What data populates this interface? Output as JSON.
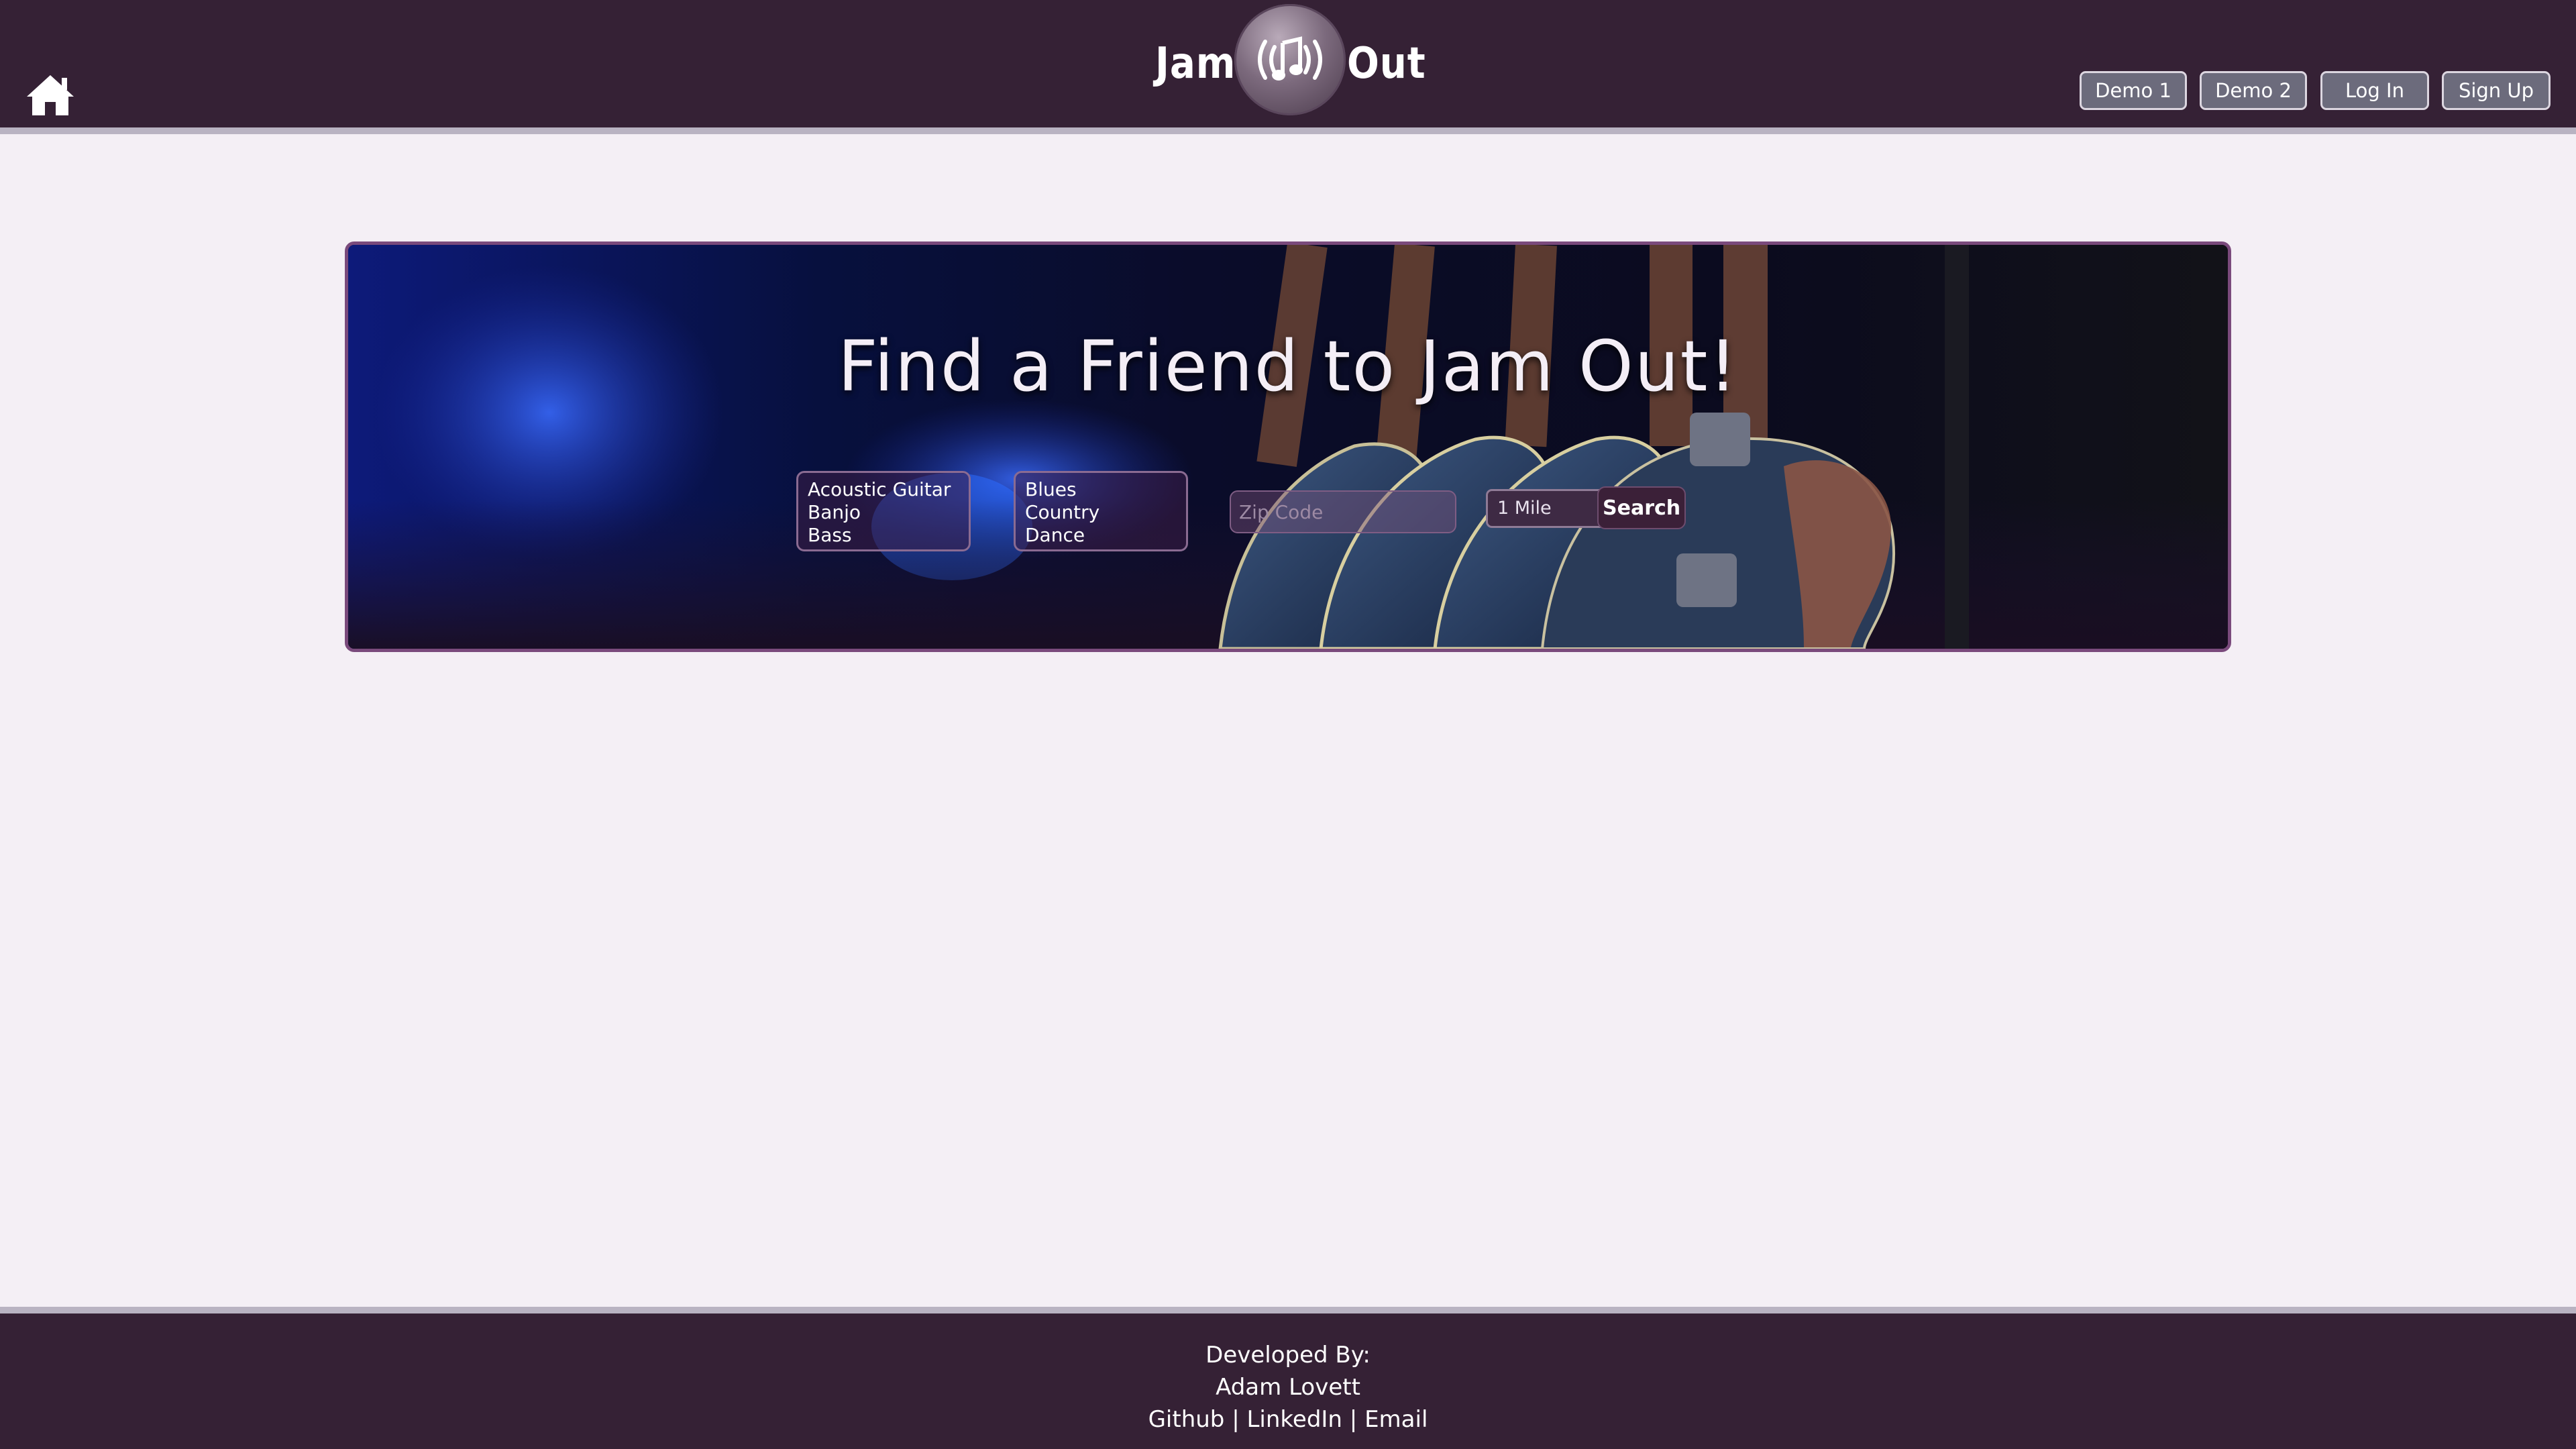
{
  "header": {
    "logo": {
      "left_word": "Jam",
      "right_word": "Out"
    },
    "nav": {
      "demo1": "Demo 1",
      "demo2": "Demo 2",
      "login": "Log In",
      "signup": "Sign Up"
    },
    "icons": {
      "home": "home-icon",
      "logo": "music-note-icon"
    }
  },
  "hero": {
    "title": "Find a Friend to Jam Out!",
    "instruments": [
      "Acoustic Guitar",
      "Banjo",
      "Bass"
    ],
    "genres": [
      "Blues",
      "Country",
      "Dance"
    ],
    "zip_placeholder": "Zip Code",
    "distance_selected": "1 Mile",
    "search_label": "Search"
  },
  "footer": {
    "developed_by": "Developed By:",
    "developer": "Adam Lovett",
    "links": {
      "github": "Github",
      "separator": "|",
      "linkedin": "LinkedIn",
      "email": "Email"
    }
  },
  "colors": {
    "header_bg": "#352135",
    "page_bg": "#f4eff5",
    "hero_border": "#7a4a7c",
    "nav_button_bg": "#6c6b7c"
  }
}
